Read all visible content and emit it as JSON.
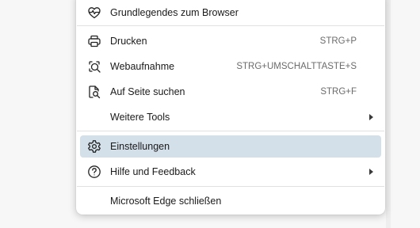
{
  "menu": {
    "items": [
      {
        "label": "Grundlegendes zum Browser",
        "icon": "heartbeat-icon"
      },
      {
        "label": "Drucken",
        "shortcut": "STRG+P",
        "icon": "printer-icon"
      },
      {
        "label": "Webaufnahme",
        "shortcut": "STRG+UMSCHALTTASTE+S",
        "icon": "web-capture-icon"
      },
      {
        "label": "Auf Seite suchen",
        "shortcut": "STRG+F",
        "icon": "find-on-page-icon"
      },
      {
        "label": "Weitere Tools",
        "icon": ""
      },
      {
        "label": "Einstellungen",
        "icon": "gear-icon"
      },
      {
        "label": "Hilfe und Feedback",
        "icon": "help-icon"
      },
      {
        "label": "Microsoft Edge schließen",
        "icon": ""
      }
    ],
    "selected_item": "Einstellungen",
    "selected_color": "#d3dfe9"
  }
}
